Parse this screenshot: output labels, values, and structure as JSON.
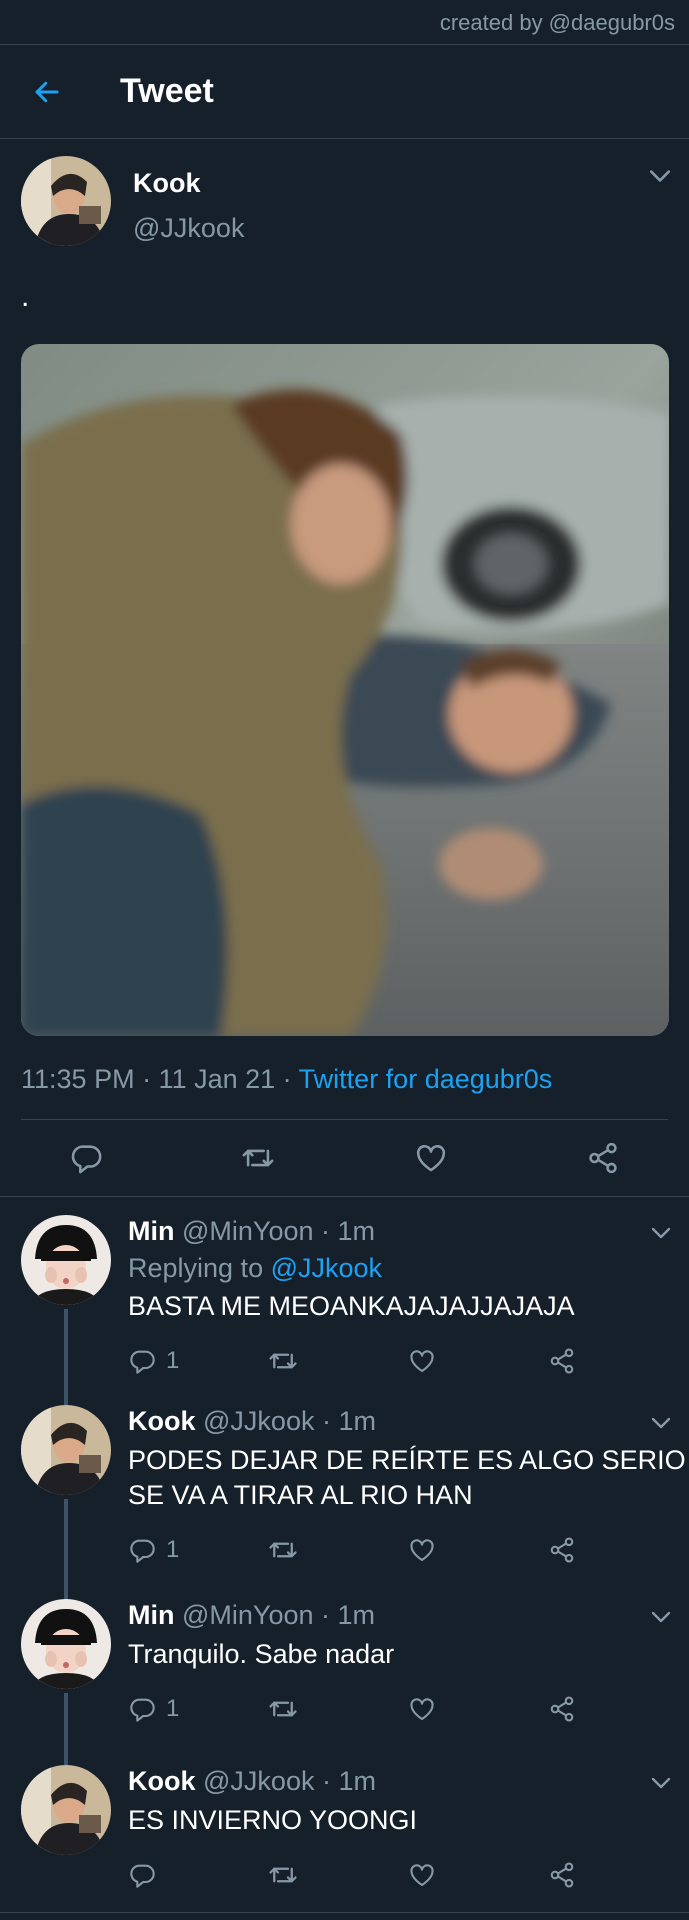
{
  "credit": "created by @daegubr0s",
  "header": {
    "title": "Tweet"
  },
  "main_tweet": {
    "name": "Kook",
    "handle": "@JJkook",
    "text": ".",
    "time_date": "11:35 PM · 11 Jan 21 · ",
    "source": "Twitter for daegubr0s"
  },
  "replies": [
    {
      "name": "Min",
      "handle": "@MinYoon · 1m",
      "replying_prefix": "Replying to ",
      "replying_to": "@JJkook",
      "text": "BASTA ME MEOANKAJAJAJJAJAJA",
      "reply_count": "1"
    },
    {
      "name": "Kook",
      "handle": "@JJkook · 1m",
      "text": "PODES DEJAR DE REÍRTE ES ALGO SERIO SE VA A TIRAR AL RIO HAN",
      "reply_count": "1"
    },
    {
      "name": "Min",
      "handle": "@MinYoon · 1m",
      "text": "Tranquilo. Sabe nadar",
      "reply_count": "1"
    },
    {
      "name": "Kook",
      "handle": "@JJkook · 1m",
      "text": "ES INVIERNO YOONGI",
      "reply_count": ""
    }
  ],
  "icons": {
    "back": "arrow-left-icon",
    "reply": "comment-icon",
    "retweet": "retweet-icon",
    "like": "heart-icon",
    "share": "share-icon",
    "more": "chevron-down-icon"
  },
  "colors": {
    "background": "#15202b",
    "accent": "#1da1f2",
    "secondary_text": "#8899a6",
    "divider": "#38444d",
    "thread_line": "#3d5466"
  }
}
